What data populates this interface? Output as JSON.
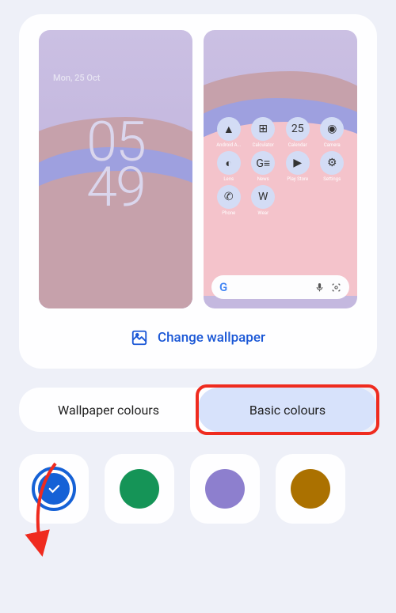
{
  "lockscreen": {
    "date": "Mon, 25 Oct",
    "time_top": "05",
    "time_bottom": "49"
  },
  "apps": [
    {
      "label": "Android A...",
      "glyph": "▲"
    },
    {
      "label": "Calculator",
      "glyph": "⊞"
    },
    {
      "label": "Calendar",
      "glyph": "25"
    },
    {
      "label": "Camera",
      "glyph": "◉"
    },
    {
      "label": "Lens",
      "glyph": "◐"
    },
    {
      "label": "News",
      "glyph": "G≡"
    },
    {
      "label": "Play Store",
      "glyph": "▶"
    },
    {
      "label": "Settings",
      "glyph": "⚙"
    },
    {
      "label": "Phone",
      "glyph": "✆"
    },
    {
      "label": "Wear",
      "glyph": "W"
    },
    {
      "label": "",
      "glyph": ""
    },
    {
      "label": "",
      "glyph": ""
    }
  ],
  "search": {
    "logo": "G"
  },
  "change_label": "Change wallpaper",
  "tabs": {
    "wallpaper": "Wallpaper colours",
    "basic": "Basic colours"
  },
  "swatches": [
    {
      "color": "#1561d6",
      "selected": true
    },
    {
      "color": "#159457",
      "selected": false
    },
    {
      "color": "#8d7fce",
      "selected": false
    },
    {
      "color": "#ab7100",
      "selected": false
    }
  ],
  "annotation": {
    "arrow_color": "#ef2b1f"
  }
}
